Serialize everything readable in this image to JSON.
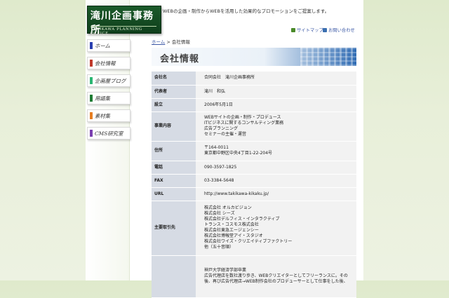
{
  "logo": {
    "title": "滝川企画事務所",
    "subtitle": "TAKIKAWA PLANNING OFFICE"
  },
  "header": {
    "tagline": "WEBの企画・制作からWEBを活用した効果的なプロモーションをご提案します。",
    "links": [
      {
        "label": "サイトマップ",
        "icon": "sitemap-icon",
        "color": "#4a8a2a"
      },
      {
        "label": "お問い合わせ",
        "icon": "mail-icon",
        "color": "#3b6fb0"
      }
    ]
  },
  "nav": [
    {
      "label": "ホーム",
      "color": "#2a3fb0",
      "icon": "home-icon"
    },
    {
      "label": "会社情報",
      "color": "#c0392b",
      "icon": "company-icon"
    },
    {
      "label": "企画屋ブログ",
      "color": "#2bb673",
      "icon": "blog-icon"
    },
    {
      "label": "用語集",
      "color": "#1e7b34",
      "icon": "glossary-icon"
    },
    {
      "label": "素材集",
      "color": "#e67e22",
      "icon": "materials-icon"
    },
    {
      "label": "CMS研究室",
      "color": "#7a3fb0",
      "icon": "cms-icon"
    }
  ],
  "breadcrumb": {
    "home": "ホーム",
    "separator": " > ",
    "current": "会社情報"
  },
  "page": {
    "title": "会社情報"
  },
  "company_table": [
    {
      "key": "会社名",
      "lines": [
        "合同会社　滝川企画事務所"
      ]
    },
    {
      "key": "代表者",
      "lines": [
        "滝川　和弘"
      ]
    },
    {
      "key": "設立",
      "lines": [
        "2006年5月1日"
      ]
    },
    {
      "key": "事業内容",
      "lines": [
        "WEBサイトの企画・制作・プロデュース",
        "ITビジネスに関するコンサルティング業務",
        "広告プランニング",
        "セミナーの主催・運営"
      ]
    },
    {
      "key": "住所",
      "lines": [
        "〒164-0011",
        "東京都中野区中央4丁目1-22-204号"
      ]
    },
    {
      "key": "電話",
      "lines": [
        "090-3597-1825"
      ]
    },
    {
      "key": "FAX",
      "lines": [
        "03-3384-5648"
      ]
    },
    {
      "key": "URL",
      "lines": [
        "http://www.takikawa-kikaku.jp/"
      ]
    },
    {
      "key": "主要取引先",
      "lines": [
        "株式会社 オルカビジョン",
        "株式会社 シーズ",
        "株式会社デルフィス・インタラクティブ",
        "トランス・コスモス株式会社",
        "株式会社東急エージェンシー",
        "株式会社博報堂アイ・スタジオ",
        "株式会社ワイズ・クリエイティブファクトリー",
        "他（五十音順）"
      ]
    },
    {
      "key": "",
      "lines": [
        "神戸大学経済学部卒業",
        "広告代理店を数社渡り歩き、WEBクリエイターとしてフリーランスに。その",
        "後、再び広告代理店→WEB制作会社のプロデューサーとして仕事をした後、"
      ]
    }
  ]
}
